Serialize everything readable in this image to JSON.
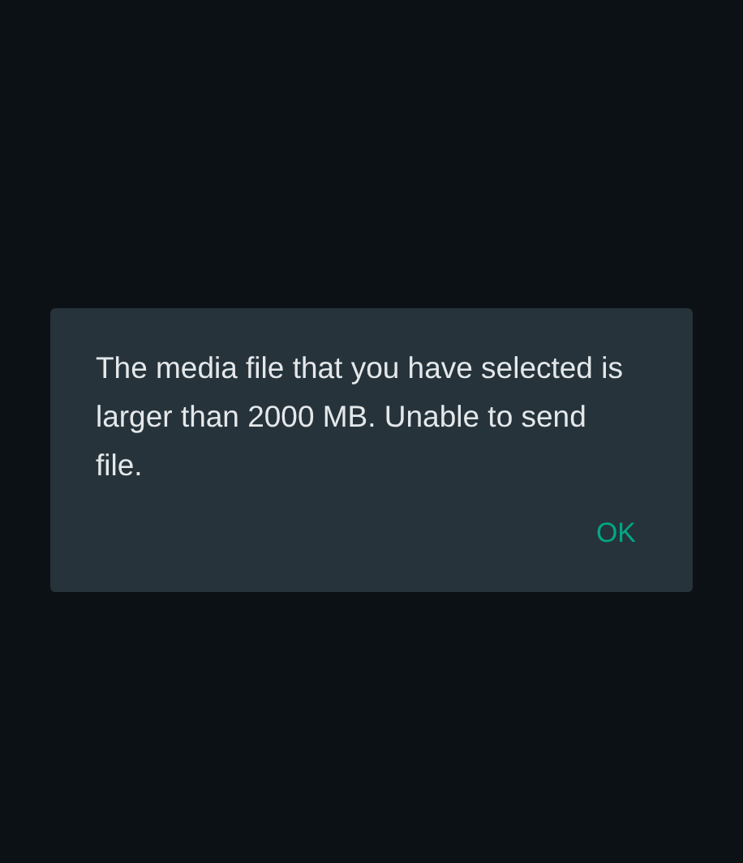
{
  "dialog": {
    "message": "The media file that you have selected is larger than 2000 MB. Unable to send file.",
    "buttons": [
      "OK"
    ]
  }
}
